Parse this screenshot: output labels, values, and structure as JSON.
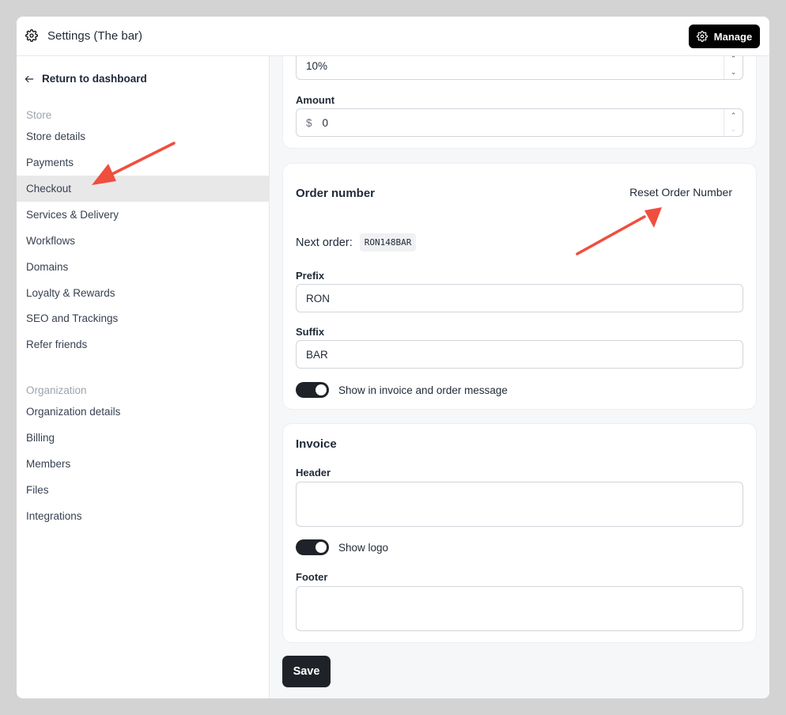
{
  "header": {
    "title": "Settings (The bar)",
    "manage_label": "Manage"
  },
  "sidebar": {
    "back_label": "Return to dashboard",
    "store_section": "Store",
    "store_items": [
      {
        "label": "Store details"
      },
      {
        "label": "Payments"
      },
      {
        "label": "Checkout",
        "active": true
      },
      {
        "label": "Services & Delivery"
      },
      {
        "label": "Workflows"
      },
      {
        "label": "Domains"
      },
      {
        "label": "Loyalty & Rewards"
      },
      {
        "label": "SEO and Trackings"
      },
      {
        "label": "Refer friends"
      }
    ],
    "org_section": "Organization",
    "org_items": [
      {
        "label": "Organization details"
      },
      {
        "label": "Billing"
      },
      {
        "label": "Members"
      },
      {
        "label": "Files"
      },
      {
        "label": "Integrations"
      }
    ]
  },
  "tax_card": {
    "rate_value": "10%",
    "amount_label": "Amount",
    "amount_prefix": "$",
    "amount_value": "0"
  },
  "order_card": {
    "title": "Order number",
    "reset_label": "Reset Order Number",
    "next_order_label": "Next order:",
    "next_order_value": "RON148BAR",
    "prefix_label": "Prefix",
    "prefix_value": "RON",
    "suffix_label": "Suffix",
    "suffix_value": "BAR",
    "show_toggle_label": "Show in invoice and order message",
    "show_toggle_on": true
  },
  "invoice_card": {
    "title": "Invoice",
    "header_label": "Header",
    "header_value": "",
    "show_logo_label": "Show logo",
    "show_logo_on": true,
    "footer_label": "Footer",
    "footer_value": ""
  },
  "save_label": "Save",
  "colors": {
    "accent": "#1f2329",
    "annotation_arrow": "#f04e3e",
    "active_nav_bg": "#e8e8e8"
  },
  "icons": {
    "header": "gear-icon",
    "manage": "gear-icon",
    "back": "arrow-left-icon"
  }
}
